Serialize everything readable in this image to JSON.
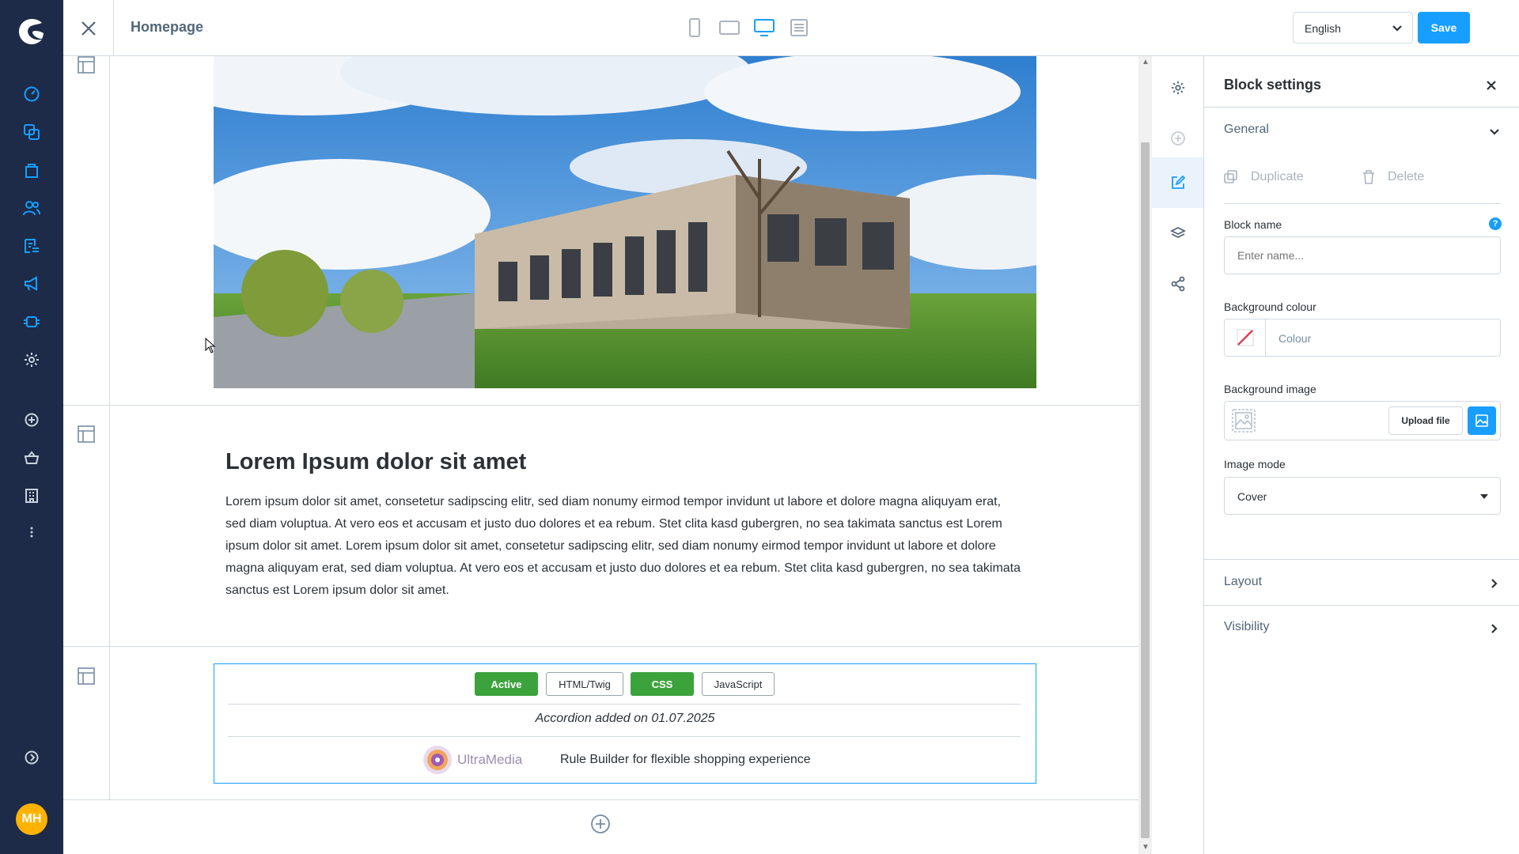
{
  "header": {
    "page_title": "Homepage",
    "language": "English",
    "save_label": "Save"
  },
  "sidebar": {
    "avatar_initials": "MH",
    "items": [
      {
        "icon": "dashboard-icon"
      },
      {
        "icon": "catalogues-icon"
      },
      {
        "icon": "orders-icon"
      },
      {
        "icon": "customers-icon"
      },
      {
        "icon": "content-icon"
      },
      {
        "icon": "marketing-icon"
      },
      {
        "icon": "extensions-icon"
      },
      {
        "icon": "settings-icon"
      },
      {
        "icon": "add-circle-icon"
      },
      {
        "icon": "basket-icon"
      },
      {
        "icon": "store-icon"
      },
      {
        "icon": "more-icon"
      },
      {
        "icon": "collapse-icon"
      }
    ]
  },
  "content": {
    "heading": "Lorem Ipsum dolor sit amet",
    "paragraph": "Lorem ipsum dolor sit amet, consetetur sadipscing elitr, sed diam nonumy eirmod tempor invidunt ut labore et dolore magna aliquyam erat, sed diam voluptua. At vero eos et accusam et justo duo dolores et ea rebum. Stet clita kasd gubergren, no sea takimata sanctus est Lorem ipsum dolor sit amet. Lorem ipsum dolor sit amet, consetetur sadipscing elitr, sed diam nonumy eirmod tempor invidunt ut labore et dolore magna aliquyam erat, sed diam voluptua. At vero eos et accusam et justo duo dolores et ea rebum. Stet clita kasd gubergren, no sea takimata sanctus est Lorem ipsum dolor sit amet.",
    "html_block": {
      "tabs": [
        "Active",
        "HTML/Twig",
        "CSS",
        "JavaScript"
      ],
      "accordion_text": "Accordion added on 01.07.2025",
      "logo_text": "UltraMedia",
      "rule_text": "Rule Builder for flexible shopping experience"
    }
  },
  "panel": {
    "title": "Block settings",
    "general_label": "General",
    "duplicate_label": "Duplicate",
    "delete_label": "Delete",
    "block_name_label": "Block name",
    "block_name_placeholder": "Enter name...",
    "help_label": "?",
    "bg_colour_label": "Background colour",
    "bg_colour_placeholder": "Colour",
    "bg_image_label": "Background image",
    "upload_label": "Upload file",
    "image_mode_label": "Image mode",
    "image_mode_value": "Cover",
    "layout_label": "Layout",
    "visibility_label": "Visibility"
  },
  "colors": {
    "accent": "#189eff",
    "sidebar_bg": "#1d2b48",
    "tab_active": "#3ca33c",
    "avatar": "#ffb300"
  }
}
